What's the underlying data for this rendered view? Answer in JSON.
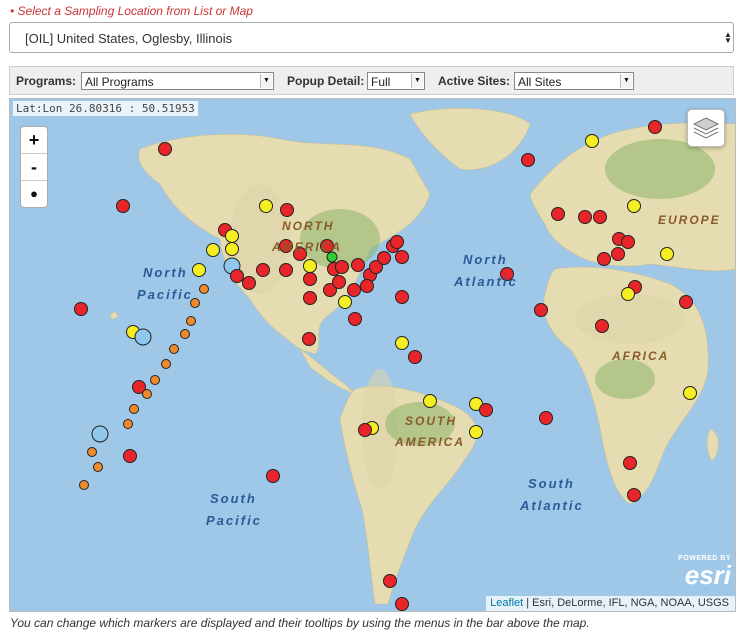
{
  "location": {
    "prompt": "• Select a Sampling Location from List or Map",
    "selected": "[OIL] United States, Oglesby, Illinois"
  },
  "toolbar": {
    "programs_label": "Programs:",
    "programs_value": "All Programs",
    "popup_label": "Popup Detail:",
    "popup_value": "Full",
    "sites_label": "Active Sites:",
    "sites_value": "All Sites"
  },
  "map": {
    "latlon": "Lat:Lon 26.80316 : 50.51953",
    "zoom_in": "+",
    "zoom_out": "-",
    "labels": {
      "north_america_1": "NORTH",
      "north_america_2": "AMERICA",
      "north_pacific_1": "North",
      "north_pacific_2": "Pacific",
      "north_atlantic_1": "North",
      "north_atlantic_2": "Atlantic",
      "europe": "EUROPE",
      "africa": "AFRICA",
      "south_america_1": "SOUTH",
      "south_america_2": "AMERICA",
      "south_pacific_1": "South",
      "south_pacific_2": "Pacific",
      "south_atlantic_1": "South",
      "south_atlantic_2": "Atlantic"
    },
    "attribution_link": "Leaflet",
    "attribution_text": "| Esri, DeLorme, IFL, NGA, NOAA, USGS",
    "esri_powered": "POWERED BY",
    "esri_name": "esri",
    "colors": {
      "ocean": "#9fc8e8",
      "land": "#e9dfb8",
      "red_marker": "#e8262a",
      "yellow_marker": "#f5ee22",
      "orange_marker": "#ee8a2a",
      "blue_marker": "#8fc8ec",
      "green_marker": "#33cc33"
    }
  },
  "footer": "You can change which markers are displayed and their tooltips by using the menus in the bar above the map."
}
